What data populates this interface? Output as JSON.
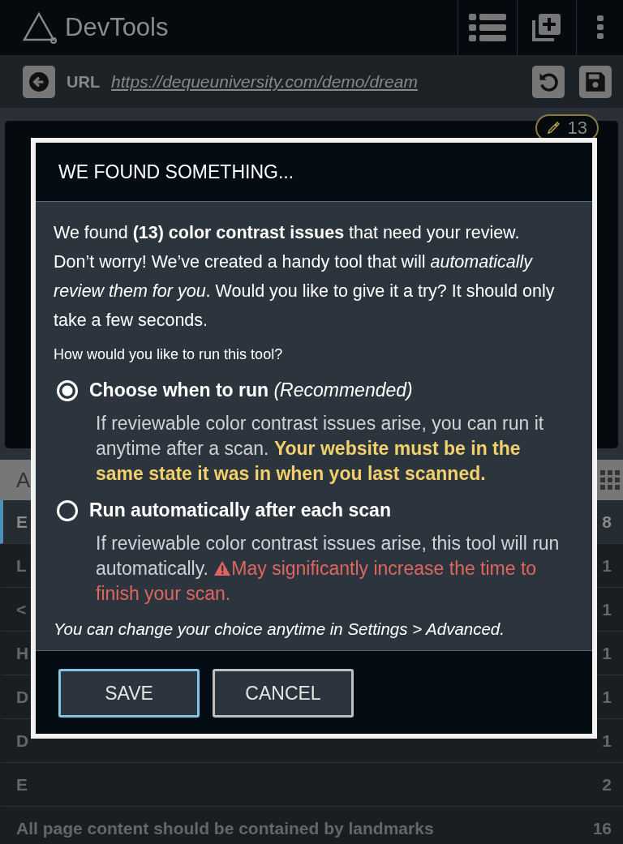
{
  "header": {
    "title": "DevTools"
  },
  "url_bar": {
    "label": "URL",
    "url": "https://dequeuniversity.com/demo/dream"
  },
  "issue_badge": {
    "count": "13"
  },
  "list_header": {
    "label": "A"
  },
  "rows": [
    {
      "label": "E",
      "count": "8",
      "selected": true
    },
    {
      "label": "L",
      "count": "1",
      "selected": false
    },
    {
      "label": "<",
      "count": "1",
      "selected": false
    },
    {
      "label": "H",
      "count": "1",
      "selected": false
    },
    {
      "label": "D",
      "count": "1",
      "selected": false
    },
    {
      "label": "D",
      "count": "1",
      "selected": false
    },
    {
      "label": "E",
      "count": "2",
      "selected": false
    },
    {
      "label": "All page content should be contained by landmarks",
      "count": "16",
      "selected": false
    }
  ],
  "dialog": {
    "title": "WE FOUND SOMETHING...",
    "intro": "We found **(13) color contrast issues** that need your review. Don’t worry! We’ve created a handy tool that will *automatically review them for you*. Would you like to give it a try? It should only take a few seconds.",
    "question": "How would you like to run this tool?",
    "options": [
      {
        "label": "Choose when to run",
        "note": "(Recommended)",
        "selected": true,
        "description": "If reviewable color contrast issues arise, you can run it anytime after a scan.",
        "highlight": "Your website must be in the same state it was in when you last scanned.",
        "kind": "info"
      },
      {
        "label": "Run automatically after each scan",
        "selected": false,
        "description": "If reviewable color contrast issues arise, this tool will run automatically.",
        "highlight": "May significantly increase the time to finish your scan.",
        "kind": "warning"
      }
    ],
    "footnote": "You can change your choice anytime in Settings > Advanced.",
    "buttons": [
      {
        "label": "SAVE",
        "focused": true
      },
      {
        "label": "CANCEL",
        "focused": false
      }
    ]
  }
}
